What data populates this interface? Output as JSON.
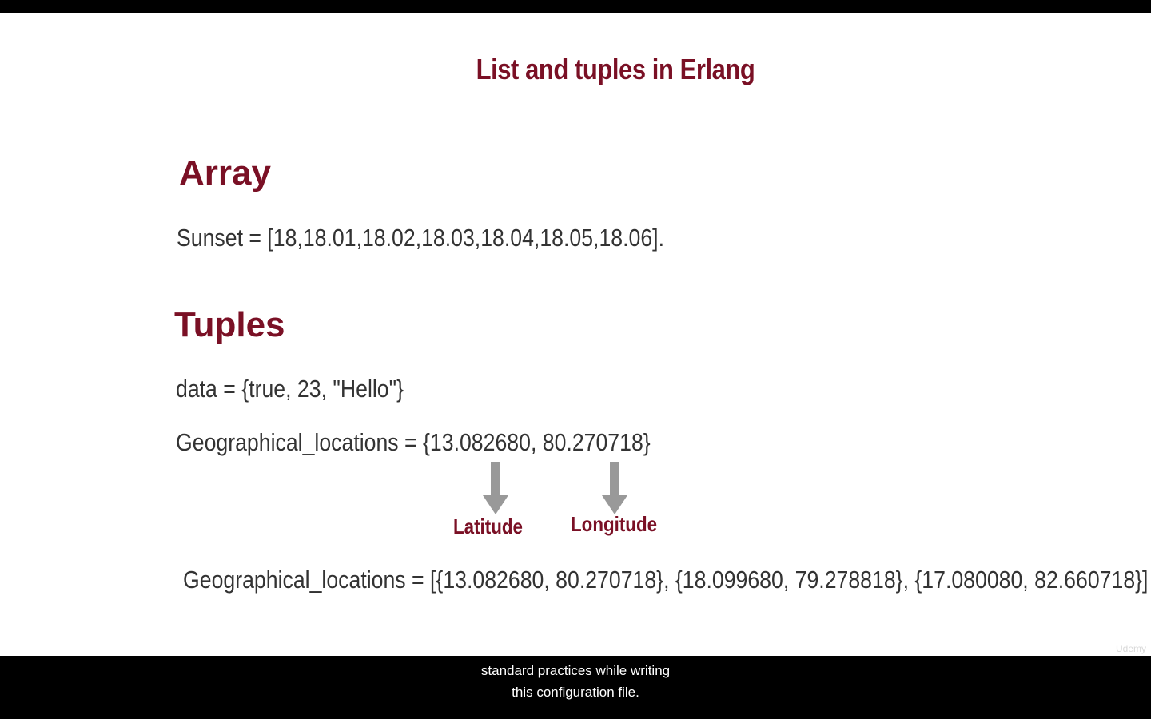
{
  "slide": {
    "title": "List and tuples in Erlang",
    "array_heading": "Array",
    "array_line": "Sunset = [18,18.01,18.02,18.03,18.04,18.05,18.06].",
    "tuples_heading": "Tuples",
    "tuple_line_1": "data = {true, 23, \"Hello\"}",
    "tuple_line_2": "Geographical_locations = {13.082680, 80.270718}",
    "latitude_label": "Latitude",
    "longitude_label": "Longitude",
    "list_of_tuples_line": "Geographical_locations =  [{13.082680, 80.270718}, {18.099680, 79.278818}, {17.080080, 82.660718}]",
    "watermark": "Udemy"
  },
  "captions": {
    "line_1": "standard practices while writing",
    "line_2": "this configuration file."
  },
  "colors": {
    "accent": "#7a1025",
    "body_text": "#333333",
    "arrow": "#999999"
  }
}
